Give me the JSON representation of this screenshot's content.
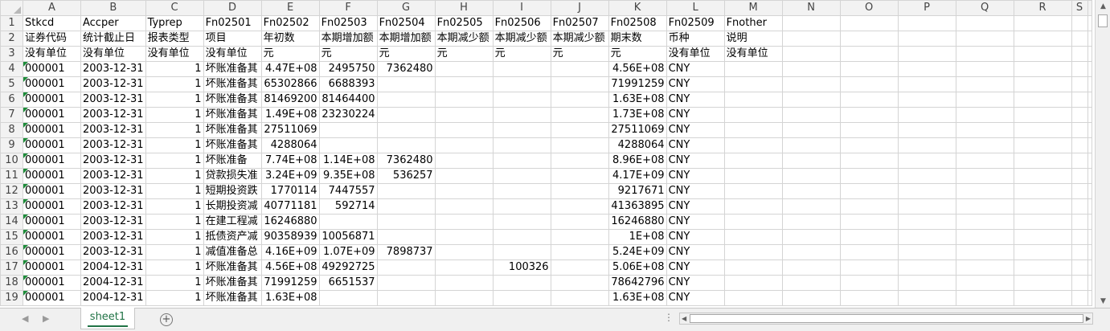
{
  "columns": [
    "A",
    "B",
    "C",
    "D",
    "E",
    "F",
    "G",
    "H",
    "I",
    "J",
    "K",
    "L",
    "M",
    "N",
    "O",
    "P",
    "Q",
    "R",
    "S"
  ],
  "rows": [
    [
      "Stkcd",
      "Accper",
      "Typrep",
      "Fn02501",
      "Fn02502",
      "Fn02503",
      "Fn02504",
      "Fn02505",
      "Fn02506",
      "Fn02507",
      "Fn02508",
      "Fn02509",
      "Fnother",
      "",
      "",
      "",
      "",
      "",
      ""
    ],
    [
      "证券代码",
      "统计截止日",
      "报表类型",
      "项目",
      "年初数",
      "本期增加额",
      "本期增加额",
      "本期减少额",
      "本期减少额",
      "本期减少额",
      "期末数",
      "币种",
      "说明",
      "",
      "",
      "",
      "",
      "",
      ""
    ],
    [
      "没有单位",
      "没有单位",
      "没有单位",
      "没有单位",
      "元",
      "元",
      "元",
      "元",
      "元",
      "元",
      "元",
      "没有单位",
      "没有单位",
      "",
      "",
      "",
      "",
      "",
      ""
    ],
    [
      "000001",
      "2003-12-31",
      "1",
      "坏账准备其",
      "4.47E+08",
      "2495750",
      "7362480",
      "",
      "",
      "",
      "4.56E+08",
      "CNY",
      "",
      "",
      "",
      "",
      "",
      "",
      ""
    ],
    [
      "000001",
      "2003-12-31",
      "1",
      "坏账准备其",
      "65302866",
      "6688393",
      "",
      "",
      "",
      "",
      "71991259",
      "CNY",
      "",
      "",
      "",
      "",
      "",
      "",
      ""
    ],
    [
      "000001",
      "2003-12-31",
      "1",
      "坏账准备其",
      "81469200",
      "81464400",
      "",
      "",
      "",
      "",
      "1.63E+08",
      "CNY",
      "",
      "",
      "",
      "",
      "",
      "",
      ""
    ],
    [
      "000001",
      "2003-12-31",
      "1",
      "坏账准备其",
      "1.49E+08",
      "23230224",
      "",
      "",
      "",
      "",
      "1.73E+08",
      "CNY",
      "",
      "",
      "",
      "",
      "",
      "",
      ""
    ],
    [
      "000001",
      "2003-12-31",
      "1",
      "坏账准备其",
      "27511069",
      "",
      "",
      "",
      "",
      "",
      "27511069",
      "CNY",
      "",
      "",
      "",
      "",
      "",
      "",
      ""
    ],
    [
      "000001",
      "2003-12-31",
      "1",
      "坏账准备其",
      "4288064",
      "",
      "",
      "",
      "",
      "",
      "4288064",
      "CNY",
      "",
      "",
      "",
      "",
      "",
      "",
      ""
    ],
    [
      "000001",
      "2003-12-31",
      "1",
      "坏账准备",
      "7.74E+08",
      "1.14E+08",
      "7362480",
      "",
      "",
      "",
      "8.96E+08",
      "CNY",
      "",
      "",
      "",
      "",
      "",
      "",
      ""
    ],
    [
      "000001",
      "2003-12-31",
      "1",
      "贷款损失准",
      "3.24E+09",
      "9.35E+08",
      "536257",
      "",
      "",
      "",
      "4.17E+09",
      "CNY",
      "",
      "",
      "",
      "",
      "",
      "",
      ""
    ],
    [
      "000001",
      "2003-12-31",
      "1",
      "短期投资跌",
      "1770114",
      "7447557",
      "",
      "",
      "",
      "",
      "9217671",
      "CNY",
      "",
      "",
      "",
      "",
      "",
      "",
      ""
    ],
    [
      "000001",
      "2003-12-31",
      "1",
      "长期投资减",
      "40771181",
      "592714",
      "",
      "",
      "",
      "",
      "41363895",
      "CNY",
      "",
      "",
      "",
      "",
      "",
      "",
      ""
    ],
    [
      "000001",
      "2003-12-31",
      "1",
      "在建工程减",
      "16246880",
      "",
      "",
      "",
      "",
      "",
      "16246880",
      "CNY",
      "",
      "",
      "",
      "",
      "",
      "",
      ""
    ],
    [
      "000001",
      "2003-12-31",
      "1",
      "抵债资产减",
      "90358939",
      "10056871",
      "",
      "",
      "",
      "",
      "1E+08",
      "CNY",
      "",
      "",
      "",
      "",
      "",
      "",
      ""
    ],
    [
      "000001",
      "2003-12-31",
      "1",
      "减值准备总",
      "4.16E+09",
      "1.07E+09",
      "7898737",
      "",
      "",
      "",
      "5.24E+09",
      "CNY",
      "",
      "",
      "",
      "",
      "",
      "",
      ""
    ],
    [
      "000001",
      "2004-12-31",
      "1",
      "坏账准备其",
      "4.56E+08",
      "49292725",
      "",
      "",
      "100326",
      "",
      "5.06E+08",
      "CNY",
      "",
      "",
      "",
      "",
      "",
      "",
      ""
    ],
    [
      "000001",
      "2004-12-31",
      "1",
      "坏账准备其",
      "71991259",
      "6651537",
      "",
      "",
      "",
      "",
      "78642796",
      "CNY",
      "",
      "",
      "",
      "",
      "",
      "",
      ""
    ],
    [
      "000001",
      "2004-12-31",
      "1",
      "坏账准备其",
      "1.63E+08",
      "",
      "",
      "",
      "",
      "",
      "1.63E+08",
      "CNY",
      "",
      "",
      "",
      "",
      "",
      "",
      ""
    ]
  ],
  "bottom": {
    "sheet_tab": "sheet1",
    "add_sheet": "+",
    "more": "⋮"
  }
}
